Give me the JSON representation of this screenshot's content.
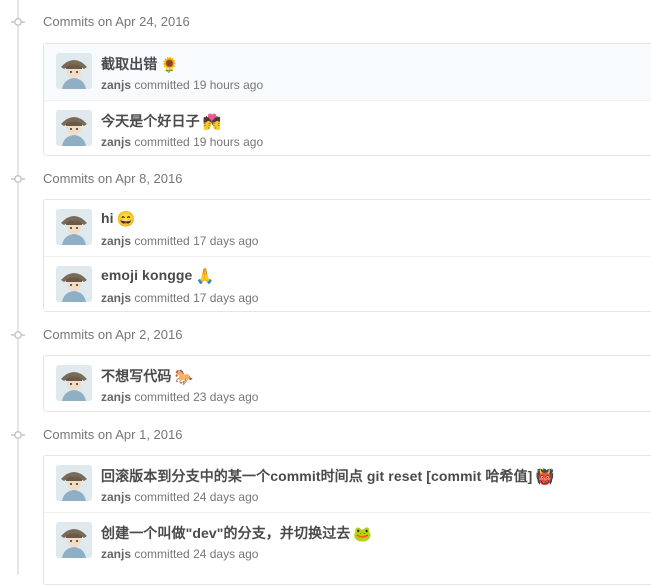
{
  "commit_groups": [
    {
      "heading": "Commits on Apr 24, 2016",
      "commits": [
        {
          "message": "截取出错",
          "emoji": "🌻",
          "emoji_name": "sunflower-icon",
          "author": "zanjs",
          "committed": "committed",
          "time": "19 hours ago"
        },
        {
          "message": "今天是个好日子",
          "emoji": "💏",
          "emoji_name": "couplekiss-icon",
          "author": "zanjs",
          "committed": "committed",
          "time": "19 hours ago"
        }
      ]
    },
    {
      "heading": "Commits on Apr 8, 2016",
      "commits": [
        {
          "message": "hi",
          "emoji": "😄",
          "emoji_name": "smile-icon",
          "author": "zanjs",
          "committed": "committed",
          "time": "17 days ago"
        },
        {
          "message": "emoji kongge",
          "emoji": "🙏",
          "emoji_name": "pray-icon",
          "author": "zanjs",
          "committed": "committed",
          "time": "17 days ago"
        }
      ]
    },
    {
      "heading": "Commits on Apr 2, 2016",
      "commits": [
        {
          "message": "不想写代码",
          "emoji": "🐎",
          "emoji_name": "horse-icon",
          "author": "zanjs",
          "committed": "committed",
          "time": "23 days ago"
        }
      ]
    },
    {
      "heading": "Commits on Apr 1, 2016",
      "commits": [
        {
          "message": "回滚版本到分支中的某一个commit时间点 git reset [commit 哈希值]",
          "emoji": "👹",
          "emoji_name": "japanese-ogre-icon",
          "author": "zanjs",
          "committed": "committed",
          "time": "24 days ago"
        },
        {
          "message": "创建一个叫做\"dev\"的分支，并切换过去",
          "emoji": "🐸",
          "emoji_name": "frog-icon",
          "author": "zanjs",
          "committed": "committed",
          "time": "24 days ago"
        }
      ]
    }
  ],
  "colors": {
    "timeline": "#e6e6e6",
    "heading": "#767676",
    "title": "#4a4a4a",
    "meta": "#767676",
    "border": "#e5e5e5"
  },
  "icons": {
    "timeline_node": "git-commit-icon",
    "avatar": "avatar"
  }
}
